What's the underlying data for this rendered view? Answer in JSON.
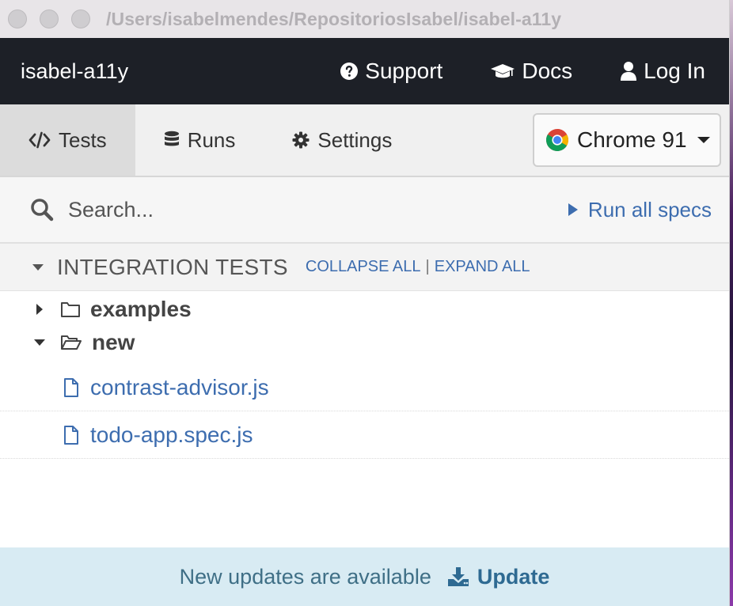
{
  "window": {
    "title": "/Users/isabelmendes/RepositoriosIsabel/isabel-a11y"
  },
  "navbar": {
    "brand": "isabel-a11y",
    "links": [
      {
        "label": "Support",
        "icon": "question-circle-icon"
      },
      {
        "label": "Docs",
        "icon": "graduation-cap-icon"
      },
      {
        "label": "Log In",
        "icon": "user-icon"
      }
    ]
  },
  "tabs": [
    {
      "label": "Tests",
      "icon": "code-icon",
      "active": true
    },
    {
      "label": "Runs",
      "icon": "database-icon",
      "active": false
    },
    {
      "label": "Settings",
      "icon": "gear-icon",
      "active": false
    }
  ],
  "browser": {
    "label": "Chrome 91",
    "icon": "chrome-icon"
  },
  "search": {
    "placeholder": "Search..."
  },
  "run_all": {
    "label": "Run all specs"
  },
  "integration": {
    "title": "INTEGRATION TESTS",
    "collapse_all": "COLLAPSE ALL",
    "separator": "|",
    "expand_all": "EXPAND ALL"
  },
  "tree": {
    "folders": [
      {
        "name": "examples",
        "expanded": false
      },
      {
        "name": "new",
        "expanded": true
      }
    ],
    "files": [
      "contrast-advisor.js",
      "todo-app.spec.js"
    ]
  },
  "footer": {
    "message": "New updates are available",
    "update_label": "Update"
  },
  "colors": {
    "navbar_bg": "#1d2027",
    "link_blue": "#3d6daf",
    "footer_bg": "#d8ebf3"
  }
}
